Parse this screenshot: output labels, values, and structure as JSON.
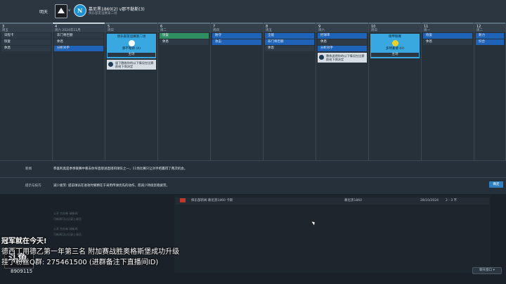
{
  "topbar": {
    "crumb": "明天",
    "vs": "v",
    "title": "慕尼黑1860(2) v那不勒斯(3)",
    "subtitle": "俱乐部友谊赛第二场"
  },
  "calendar": {
    "columns": [
      {
        "num": "3",
        "day": "周五",
        "events": [
          {
            "label": "日程卡",
            "style": "dark"
          },
          {
            "label": "恢复",
            "style": "dark"
          },
          {
            "label": "休息",
            "style": "dark"
          }
        ]
      },
      {
        "num": "4",
        "day": "周六  2024年11月",
        "events": [
          {
            "label": "非门将巨额",
            "style": "dark"
          },
          {
            "label": "休息",
            "style": "dark"
          },
          {
            "label": "分析对手",
            "style": "blue"
          }
        ]
      },
      {
        "num": "5",
        "day": "周日",
        "card": {
          "top": "俱乐部友谊赛第二场",
          "team": "那不勒斯 (A)",
          "tag": "主场"
        },
        "note": "留下教练你的以下情况在比赛前给下周决定"
      },
      {
        "num": "6",
        "day": "周二",
        "events": [
          {
            "label": "恢复",
            "style": "green"
          },
          {
            "label": "休息",
            "style": "dark"
          }
        ]
      },
      {
        "num": "7",
        "day": "周四",
        "events": [
          {
            "label": "防守",
            "style": "blue"
          },
          {
            "label": "攻击",
            "style": "blue"
          }
        ]
      },
      {
        "num": "8",
        "day": "周五",
        "events": [
          {
            "label": "全能",
            "style": "blue"
          },
          {
            "label": "非门将巨额",
            "style": "blue"
          },
          {
            "label": "休息",
            "style": "dark"
          }
        ]
      },
      {
        "num": "9",
        "day": "周六",
        "events": [
          {
            "label": "控球率",
            "style": "blue"
          },
          {
            "label": "休息",
            "style": "dark"
          },
          {
            "label": "分析对手",
            "style": "blue"
          }
        ],
        "note": "教练说明你的以下情况在比赛前给下周决定"
      },
      {
        "num": "10",
        "day": "周日",
        "card": {
          "top": "德甲联赛",
          "team": "多特蒙德 (H)",
          "tag": "主场"
        }
      },
      {
        "num": "11",
        "day": "周一",
        "events": [
          {
            "label": "恢复",
            "style": "blue"
          },
          {
            "label": "休息",
            "style": "dark"
          }
        ]
      },
      {
        "num": "12",
        "day": "周二",
        "events": [
          {
            "label": "耐力",
            "style": "blue"
          },
          {
            "label": "综合",
            "style": "blue"
          }
        ]
      }
    ]
  },
  "info": {
    "row1_label": "新闻",
    "row1_text": "恭喜利奥是季季联赛中看去你导直接进直接的球队之一，11场比赛只让对手把赢得了两次机会。",
    "row2_label": "提示与技巧",
    "row2_text": "减少疲劳: 提前球员在进攻时要精在于采用传球优先的动作。而减少持续奔跑疲劳。",
    "button": "确定"
  },
  "news": {
    "t1": "俱乐部新闻 慕尼黑1860 卡斯",
    "t2": "慕尼黑1860",
    "t3": "28/10/2024",
    "t4": "2 - 3 不"
  },
  "faint": [
    "公开 方办新 球新闻",
    "可新闻可以记录上球员",
    "公开 方办新 球新闻",
    "可新闻可以记录上球员"
  ],
  "overlay": {
    "line1": "冠军就在今天!",
    "line2": "德西丁用德乙第一年第三名 附加赛战胜奥格斯堡成功升级",
    "line3": "挂了粉丝Q群: 275461500 (进群备注下直播间ID)",
    "logo": "斗鱼",
    "room": "8909115",
    "pill": "聊天窗口 ▾"
  }
}
